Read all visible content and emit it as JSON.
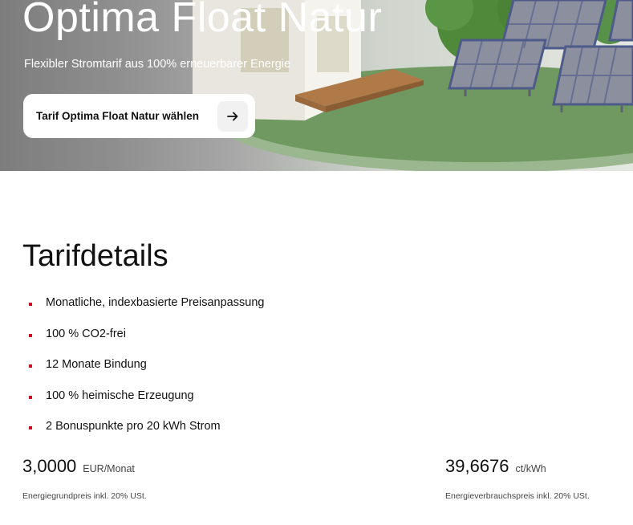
{
  "hero": {
    "title": "Optima Float Natur",
    "subtitle": "Flexibler Stromtarif aus 100% erneuerbarer Energie",
    "cta_label": "Tarif Optima Float Natur wählen",
    "cta_icon": "arrow-right-icon"
  },
  "details": {
    "title": "Tarifdetails",
    "features": [
      "Monatliche, indexbasierte Preisanpassung",
      "100 % CO2-frei",
      "12 Monate Bindung",
      "100 % heimische Erzeugung",
      "2 Bonuspunkte pro 20 kWh Strom"
    ],
    "bullet_color": "#cc0a1f"
  },
  "prices": {
    "base": {
      "value": "3,0000",
      "unit": "EUR/Monat",
      "note": "Energiegrundpreis inkl. 20% USt."
    },
    "consumption": {
      "value": "39,6676",
      "unit": "ct/kWh",
      "note": "Energieverbrauchspreis inkl. 20% USt."
    }
  }
}
